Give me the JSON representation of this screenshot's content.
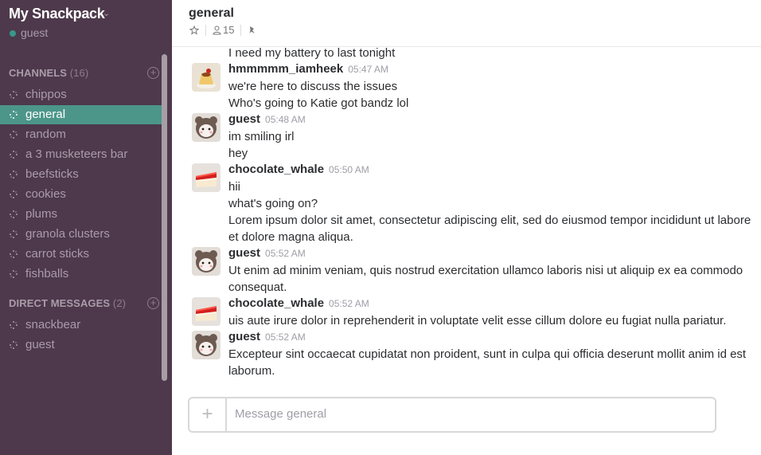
{
  "team": {
    "name": "My Snackpack",
    "caret": "⌄",
    "user": "guest",
    "presence_color": "#38978d"
  },
  "channels_section": {
    "label": "CHANNELS",
    "count": "(16)",
    "add_glyph": "+"
  },
  "channels": [
    {
      "name": "chippos"
    },
    {
      "name": "general",
      "active": true
    },
    {
      "name": "random"
    },
    {
      "name": "a 3 musketeers bar"
    },
    {
      "name": "beefsticks"
    },
    {
      "name": "cookies"
    },
    {
      "name": "plums"
    },
    {
      "name": "granola clusters"
    },
    {
      "name": "carrot sticks"
    },
    {
      "name": "fishballs"
    }
  ],
  "dm_section": {
    "label": "DIRECT MESSAGES",
    "count": "(2)",
    "add_glyph": "+"
  },
  "direct_messages": [
    {
      "name": "snackbear"
    },
    {
      "name": "guest"
    }
  ],
  "header": {
    "channel": "general",
    "members": "15",
    "icons": [
      "star-icon",
      "member-icon",
      "pin-icon"
    ]
  },
  "messages": {
    "cut_line": "I need my battery to last tonight",
    "groups": [
      {
        "sender": "hmmmmm_iamheek",
        "time": "05:47 AM",
        "avatar": "pudding",
        "lines": [
          "we're here to discuss the issues",
          "Who's going to Katie got bandz lol"
        ]
      },
      {
        "sender": "guest",
        "time": "05:48 AM",
        "avatar": "bear",
        "lines": [
          "im smiling irl",
          "hey"
        ]
      },
      {
        "sender": "chocolate_whale",
        "time": "05:50 AM",
        "avatar": "cake",
        "lines": [
          "hii",
          "what's going on?",
          "Lorem ipsum dolor sit amet, consectetur adipiscing elit, sed do eiusmod tempor incididunt ut labore",
          "et dolore magna aliqua."
        ]
      },
      {
        "sender": "guest",
        "time": "05:52 AM",
        "avatar": "bear",
        "lines": [
          "Ut enim ad minim veniam, quis nostrud exercitation ullamco laboris nisi ut aliquip ex ea commodo",
          "consequat."
        ]
      },
      {
        "sender": "chocolate_whale",
        "time": "05:52 AM",
        "avatar": "cake",
        "lines": [
          "uis aute irure dolor in reprehenderit in voluptate velit esse cillum dolore eu fugiat nulla pariatur."
        ]
      },
      {
        "sender": "guest",
        "time": "05:52 AM",
        "avatar": "bear",
        "lines": [
          "Excepteur sint occaecat cupidatat non proident, sunt in culpa qui officia deserunt mollit anim id est",
          "laborum."
        ]
      }
    ]
  },
  "composer": {
    "add_glyph": "+",
    "placeholder": "Message general"
  },
  "colors": {
    "sidebar_bg": "#4d394b",
    "active_channel": "#4c9689",
    "text": "#2c2d30",
    "muted": "#9e9ea6"
  }
}
